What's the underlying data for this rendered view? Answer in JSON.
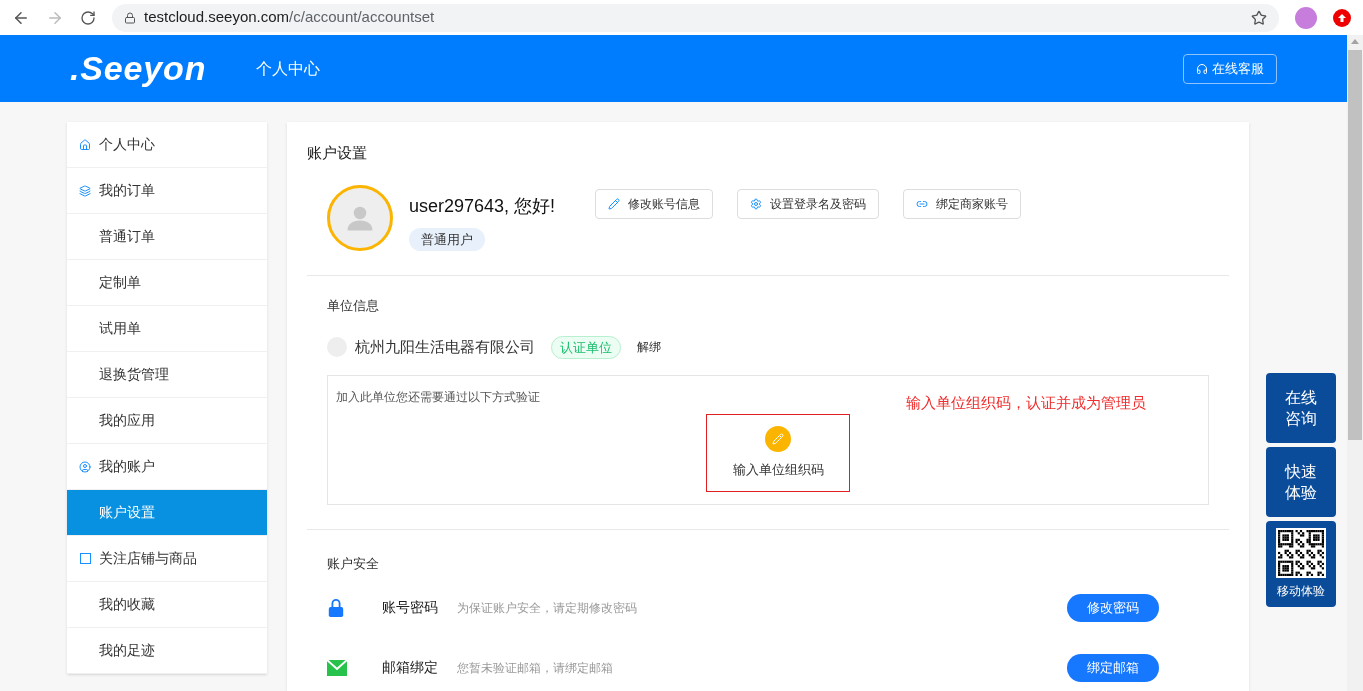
{
  "browser": {
    "url_host": "testcloud.seeyon.com",
    "url_path": "/c/account/accountset"
  },
  "header": {
    "logo": ".Seeyon",
    "title": "个人中心",
    "service_button": "在线客服"
  },
  "sidebar": {
    "items": [
      {
        "label": "个人中心",
        "kind": "section",
        "selected": false
      },
      {
        "label": "我的订单",
        "kind": "section",
        "selected": false
      },
      {
        "label": "普通订单",
        "kind": "sub",
        "selected": false
      },
      {
        "label": "定制单",
        "kind": "sub",
        "selected": false
      },
      {
        "label": "试用单",
        "kind": "sub",
        "selected": false
      },
      {
        "label": "退换货管理",
        "kind": "sub",
        "selected": false
      },
      {
        "label": "我的应用",
        "kind": "sub",
        "selected": false
      },
      {
        "label": "我的账户",
        "kind": "section",
        "selected": false
      },
      {
        "label": "账户设置",
        "kind": "sub",
        "selected": true
      },
      {
        "label": "关注店铺与商品",
        "kind": "section",
        "selected": false
      },
      {
        "label": "我的收藏",
        "kind": "sub",
        "selected": false
      },
      {
        "label": "我的足迹",
        "kind": "sub",
        "selected": false
      }
    ]
  },
  "main": {
    "title": "账户设置",
    "profile": {
      "greeting": "user297643, 您好!",
      "role": "普通用户",
      "actions": [
        "修改账号信息",
        "设置登录名及密码",
        "绑定商家账号"
      ]
    },
    "unit": {
      "heading": "单位信息",
      "company": "杭州九阳生活电器有限公司",
      "badge": "认证单位",
      "unbind": "解绑",
      "note": "加入此单位您还需要通过以下方式验证",
      "hint": "输入单位组织码，认证并成为管理员",
      "method": "输入单位组织码"
    },
    "security": {
      "heading": "账户安全",
      "rows": [
        {
          "name": "账号密码",
          "desc": "为保证账户安全，请定期修改密码",
          "button": "修改密码"
        },
        {
          "name": "邮箱绑定",
          "desc": "您暂未验证邮箱，请绑定邮箱",
          "button": "绑定邮箱"
        }
      ]
    }
  },
  "float_buttons": [
    {
      "kind": "text",
      "label": "在线咨询"
    },
    {
      "kind": "text",
      "label": "快速体验"
    },
    {
      "kind": "qr",
      "label": "移动体验"
    }
  ]
}
